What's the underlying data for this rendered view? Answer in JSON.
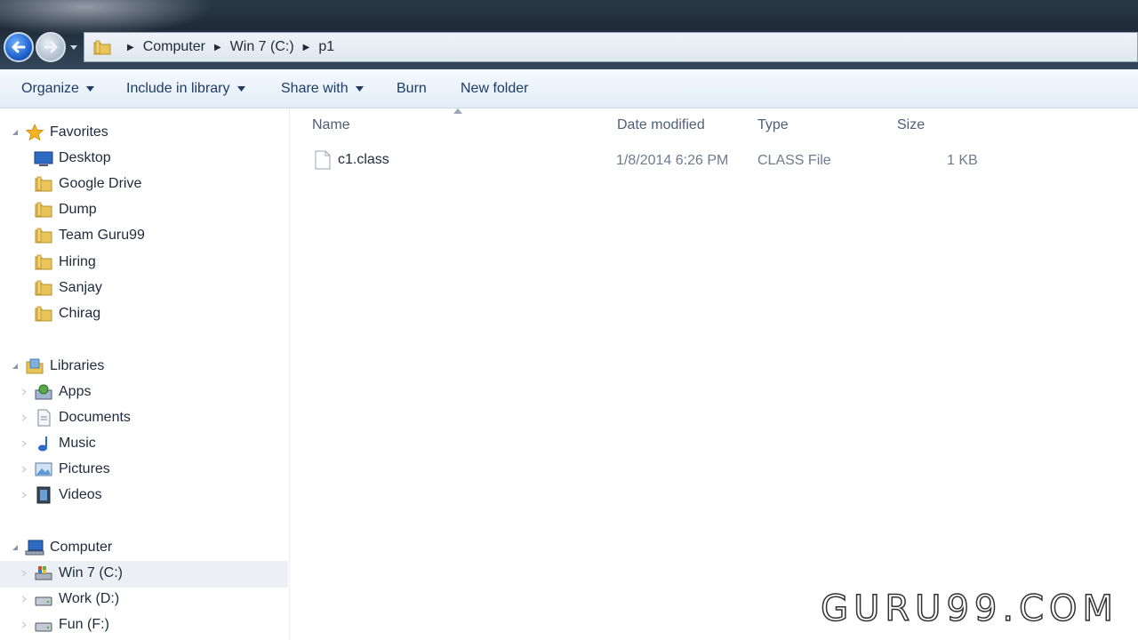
{
  "address": {
    "crumbs": [
      "Computer",
      "Win 7 (C:)",
      "p1"
    ]
  },
  "toolbar": {
    "organize": "Organize",
    "include_library": "Include in library",
    "share_with": "Share with",
    "burn": "Burn",
    "new_folder": "New folder"
  },
  "nav": {
    "favorites": {
      "label": "Favorites",
      "items": [
        "Desktop",
        "Google Drive",
        "Dump",
        "Team Guru99",
        "Hiring",
        "Sanjay",
        "Chirag"
      ]
    },
    "libraries": {
      "label": "Libraries",
      "items": [
        "Apps",
        "Documents",
        "Music",
        "Pictures",
        "Videos"
      ]
    },
    "computer": {
      "label": "Computer",
      "items": [
        "Win 7 (C:)",
        "Work (D:)",
        "Fun (F:)"
      ]
    }
  },
  "columns": {
    "name": "Name",
    "date_modified": "Date modified",
    "type": "Type",
    "size": "Size"
  },
  "files": [
    {
      "name": "c1.class",
      "date_modified": "1/8/2014 6:26 PM",
      "type": "CLASS File",
      "size": "1 KB"
    }
  ],
  "watermark": "GURU99.COM",
  "colors": {
    "accent": "#1a5ec8",
    "toolbar_text": "#1e3c64",
    "header_text": "#4d6078"
  }
}
